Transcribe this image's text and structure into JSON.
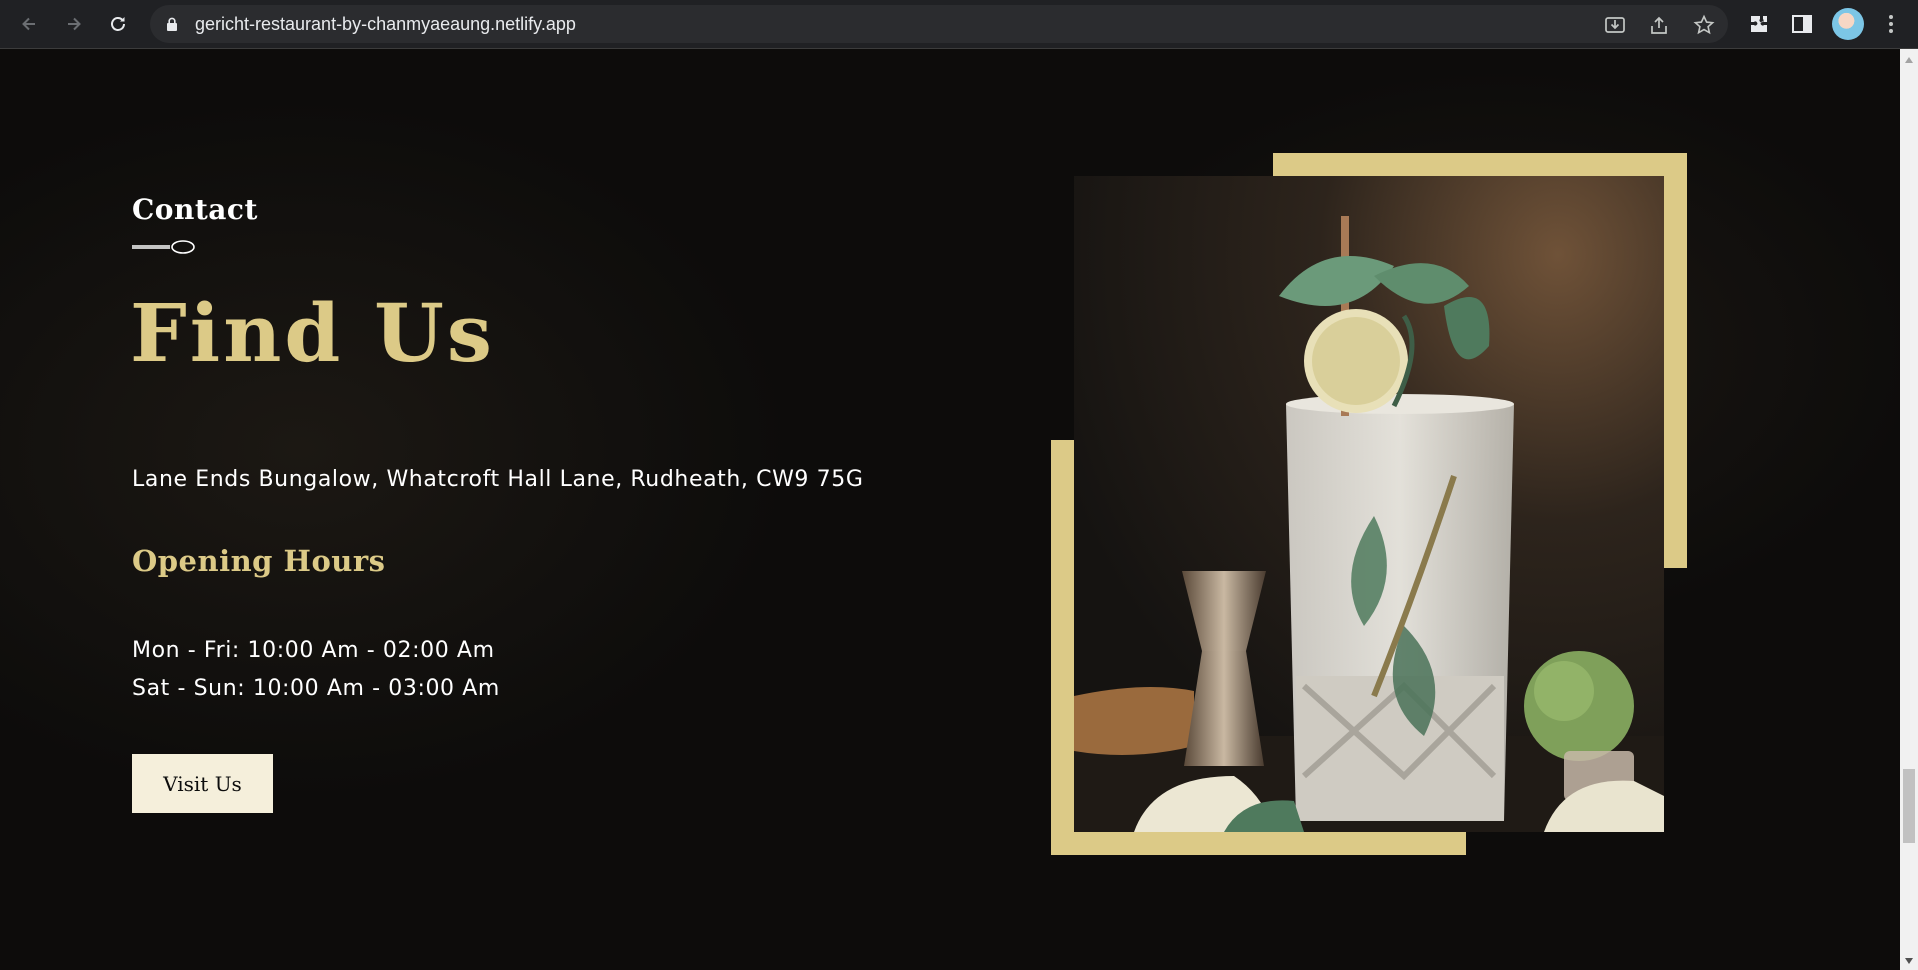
{
  "browser": {
    "url": "gericht-restaurant-by-chanmyaeaung.netlify.app"
  },
  "section": {
    "subtitle": "Contact",
    "title": "Find Us",
    "address": "Lane Ends Bungalow, Whatcroft Hall Lane, Rudheath, CW9 75G",
    "hours_title": "Opening Hours",
    "hours": [
      "Mon - Fri: 10:00 Am - 02:00 Am",
      "Sat - Sun: 10:00 Am - 03:00 Am"
    ],
    "button_label": "Visit Us"
  },
  "colors": {
    "accent_gold": "#dcca87",
    "background": "#0c0c0c",
    "button_bg": "#f5efdb",
    "text": "#ffffff"
  },
  "icons": {
    "back": "arrow-left-icon",
    "forward": "arrow-right-icon",
    "reload": "reload-icon",
    "lock": "lock-icon",
    "install": "install-icon",
    "share": "share-icon",
    "bookmark": "star-icon",
    "extensions": "puzzle-icon",
    "side_panel": "side-panel-icon",
    "menu": "more-vertical-icon",
    "divider": "spoon-icon"
  }
}
